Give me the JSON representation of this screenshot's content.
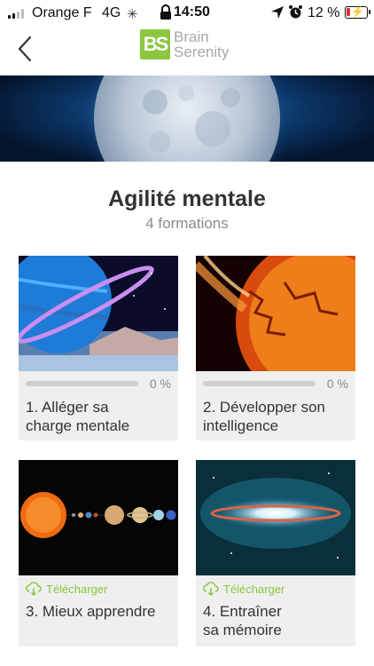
{
  "status_bar": {
    "carrier": "Orange F",
    "network": "4G",
    "time": "14:50",
    "battery_percent": "12 %",
    "battery_level": 0.12
  },
  "header": {
    "logo_mark": "BS",
    "logo_line1": "Brain",
    "logo_line2": "Serenity"
  },
  "page": {
    "title": "Agilité mentale",
    "subtitle": "4 formations"
  },
  "formations": [
    {
      "title_line1": "1. Alléger sa",
      "title_line2": "charge mentale",
      "progress_label": "0 %",
      "progress": 0,
      "image": "ringed-planet"
    },
    {
      "title_line1": "2. Développer son",
      "title_line2": "intelligence",
      "progress_label": "0 %",
      "progress": 0,
      "image": "burning-sun"
    },
    {
      "title_line1": "3. Mieux apprendre",
      "title_line2": "",
      "download_label": "Télécharger",
      "image": "solar-system"
    },
    {
      "title_line1": "4. Entraîner",
      "title_line2": "sa mémoire",
      "download_label": "Télécharger",
      "image": "galaxy"
    }
  ],
  "colors": {
    "brand_green": "#8cc63f",
    "card_bg": "#efefef",
    "battery_low": "#e03131"
  }
}
